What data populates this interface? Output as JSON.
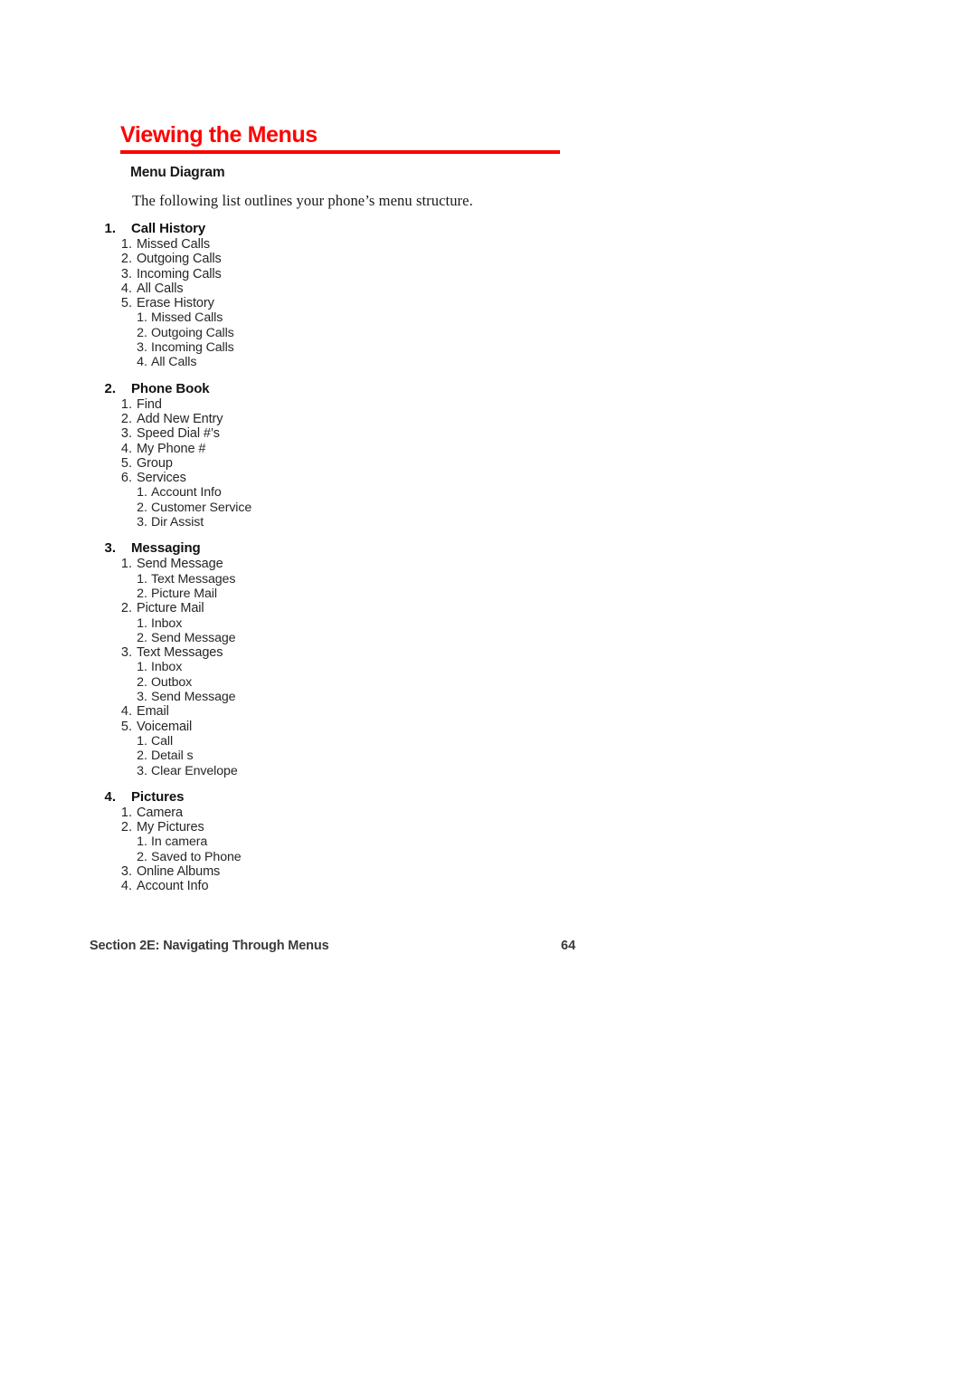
{
  "page": {
    "title": "Viewing the Menus",
    "title_color": "#ff0000",
    "sub_heading": "Menu Diagram",
    "intro_text": "The following list outlines your phone’s menu structure."
  },
  "footer": {
    "section_label": "Section 2E: Navigating Through Menus",
    "page_number": "64"
  },
  "menu": [
    {
      "num": "1.",
      "label": "Call History",
      "children": [
        {
          "num": "1.",
          "label": "Missed Calls"
        },
        {
          "num": "2.",
          "label": "Outgoing Calls"
        },
        {
          "num": "3.",
          "label": "Incoming Calls"
        },
        {
          "num": "4.",
          "label": "All Calls"
        },
        {
          "num": "5.",
          "label": "Erase History",
          "children": [
            {
              "num": "1.",
              "label": "Missed Calls"
            },
            {
              "num": "2.",
              "label": "Outgoing Calls"
            },
            {
              "num": "3.",
              "label": "Incoming Calls"
            },
            {
              "num": "4.",
              "label": "All Calls"
            }
          ]
        }
      ]
    },
    {
      "num": "2.",
      "label": "Phone Book",
      "children": [
        {
          "num": "1.",
          "label": "Find"
        },
        {
          "num": "2.",
          "label": "Add New Entry"
        },
        {
          "num": "3.",
          "label": "Speed Dial #’s"
        },
        {
          "num": "4.",
          "label": "My Phone #"
        },
        {
          "num": "5.",
          "label": "Group"
        },
        {
          "num": "6.",
          "label": "Services",
          "children": [
            {
              "num": "1.",
              "label": "Account Info"
            },
            {
              "num": "2.",
              "label": "Customer Service"
            },
            {
              "num": "3.",
              "label": "Dir Assist"
            }
          ]
        }
      ]
    },
    {
      "num": "3.",
      "label": "Messaging",
      "children": [
        {
          "num": "1.",
          "label": "Send Message",
          "children": [
            {
              "num": "1.",
              "label": "Text Messages"
            },
            {
              "num": "2.",
              "label": "Picture Mail"
            }
          ]
        },
        {
          "num": "2.",
          "label": "Picture Mail",
          "children": [
            {
              "num": "1.",
              "label": "Inbox"
            },
            {
              "num": "2.",
              "label": "Send Message"
            }
          ]
        },
        {
          "num": "3.",
          "label": "Text Messages",
          "children": [
            {
              "num": "1.",
              "label": "Inbox"
            },
            {
              "num": "2.",
              "label": "Outbox"
            },
            {
              "num": "3.",
              "label": "Send Message"
            }
          ]
        },
        {
          "num": "4.",
          "label": "Email"
        },
        {
          "num": "5.",
          "label": "Voicemail",
          "children": [
            {
              "num": "1.",
              "label": "Call"
            },
            {
              "num": "2.",
              "label": "Detail s"
            },
            {
              "num": "3.",
              "label": "Clear Envelope"
            }
          ]
        }
      ]
    },
    {
      "num": "4.",
      "label": "Pictures",
      "children": [
        {
          "num": "1.",
          "label": "Camera"
        },
        {
          "num": "2.",
          "label": "My Pictures",
          "children": [
            {
              "num": "1.",
              "label": "In camera"
            },
            {
              "num": "2.",
              "label": "Saved to Phone"
            }
          ]
        },
        {
          "num": "3.",
          "label": "Online Albums"
        },
        {
          "num": "4.",
          "label": "Account Info"
        }
      ]
    }
  ]
}
